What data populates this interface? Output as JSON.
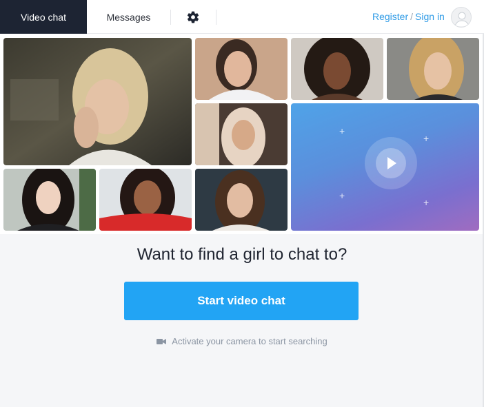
{
  "header": {
    "tabs": [
      {
        "label": "Video chat",
        "active": true
      },
      {
        "label": "Messages",
        "active": false
      }
    ],
    "settings_icon": "gear-icon",
    "register_label": "Register",
    "separator": "/",
    "signin_label": "Sign in",
    "avatar_icon": "user-avatar-icon"
  },
  "main": {
    "headline": "Want to find a girl to chat to?",
    "cta_label": "Start video chat",
    "hint_icon": "video-camera-icon",
    "hint_text": "Activate your camera to start searching"
  },
  "colors": {
    "header_dark": "#1d2433",
    "accent": "#22a4f4",
    "link": "#2f9be6",
    "page_bg": "#f5f6f8"
  }
}
